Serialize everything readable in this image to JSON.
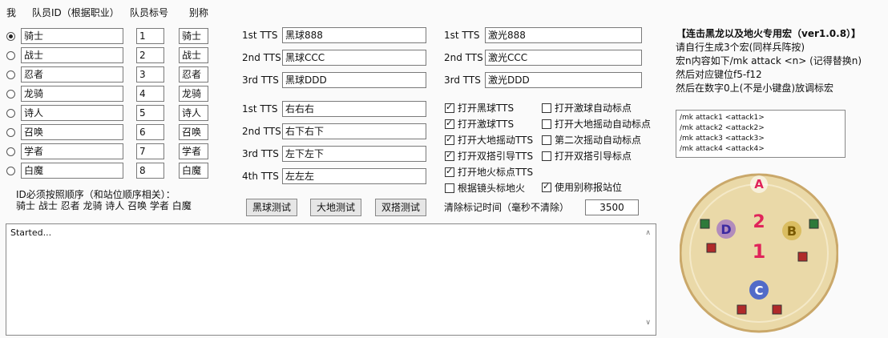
{
  "headers": {
    "col_me": "我",
    "col_id": "队员ID（根据职业）",
    "col_mark": "队员标号",
    "col_alias": "别称"
  },
  "members": [
    {
      "id": "骑士",
      "mark": "1",
      "alias": "骑士",
      "selected": true
    },
    {
      "id": "战士",
      "mark": "2",
      "alias": "战士",
      "selected": false
    },
    {
      "id": "忍者",
      "mark": "3",
      "alias": "忍者",
      "selected": false
    },
    {
      "id": "龙骑",
      "mark": "4",
      "alias": "龙骑",
      "selected": false
    },
    {
      "id": "诗人",
      "mark": "5",
      "alias": "诗人",
      "selected": false
    },
    {
      "id": "召唤",
      "mark": "6",
      "alias": "召唤",
      "selected": false
    },
    {
      "id": "学者",
      "mark": "7",
      "alias": "学者",
      "selected": false
    },
    {
      "id": "白魔",
      "mark": "8",
      "alias": "白魔",
      "selected": false
    }
  ],
  "id_note": {
    "line1": "ID必须按照顺序（和站位顺序相关）：",
    "line2": "骑士 战士 忍者 龙骑 诗人 召唤 学者 白魔"
  },
  "tts_ball": [
    {
      "label": "1st TTS",
      "value": "黑球888"
    },
    {
      "label": "2nd TTS",
      "value": "黑球CCC"
    },
    {
      "label": "3rd TTS",
      "value": "黑球DDD"
    }
  ],
  "tts_lr": [
    {
      "label": "1st TTS",
      "value": "右右右"
    },
    {
      "label": "2nd TTS",
      "value": "右下右下"
    },
    {
      "label": "3rd TTS",
      "value": "左下左下"
    },
    {
      "label": "4th TTS",
      "value": "左左左"
    }
  ],
  "tts_laser": [
    {
      "label": "1st TTS",
      "value": "激光888"
    },
    {
      "label": "2nd TTS",
      "value": "激光CCC"
    },
    {
      "label": "3rd TTS",
      "value": "激光DDD"
    }
  ],
  "buttons": {
    "ball_test": "黑球测试",
    "land_test": "大地测试",
    "double_test": "双搭测试"
  },
  "checkboxes_left": [
    {
      "label": "打开黑球TTS",
      "checked": true
    },
    {
      "label": "打开激球TTS",
      "checked": true
    },
    {
      "label": "打开大地摇动TTS",
      "checked": true
    },
    {
      "label": "打开双搭引导TTS",
      "checked": true
    },
    {
      "label": "打开地火标点TTS",
      "checked": true
    },
    {
      "label": "根据镜头标地火",
      "checked": false
    }
  ],
  "checkboxes_right": [
    {
      "label": "打开激球自动标点",
      "checked": false
    },
    {
      "label": "打开大地摇动自动标点",
      "checked": false
    },
    {
      "label": "第二次摇动自动标点",
      "checked": false
    },
    {
      "label": "打开双搭引导标点",
      "checked": false
    }
  ],
  "use_alias": {
    "label": "使用别称报站位",
    "checked": true
  },
  "timer": {
    "label": "清除标记时间（毫秒不清除）",
    "value": "3500"
  },
  "log": {
    "text": "Started..."
  },
  "info": {
    "title": "【连击黑龙以及地火专用宏（ver1.0.8）】",
    "lines": [
      "请自行生成3个宏(同样兵阵按)",
      "宏n内容如下/mk attack <n> (记得替换n)",
      "然后对应键位f5-f12",
      "然后在数字0上(不是小键盘)放调标宏"
    ]
  },
  "macro_lines": [
    "/mk attack1 <attack1>",
    "/mk attack2 <attack2>",
    "/mk attack3 <attack3>",
    "/mk attack4 <attack4>"
  ],
  "arena": {
    "marker_a": "A",
    "marker_b": "B",
    "marker_c": "C",
    "marker_d": "D",
    "num_1": "1",
    "num_2": "2",
    "colors": {
      "bg": "#ead9a8",
      "ring": "#caa86a",
      "a": "#e0245a",
      "b": "#c9a21a",
      "c": "#2a4fd0",
      "d": "#7a3fd0"
    }
  }
}
